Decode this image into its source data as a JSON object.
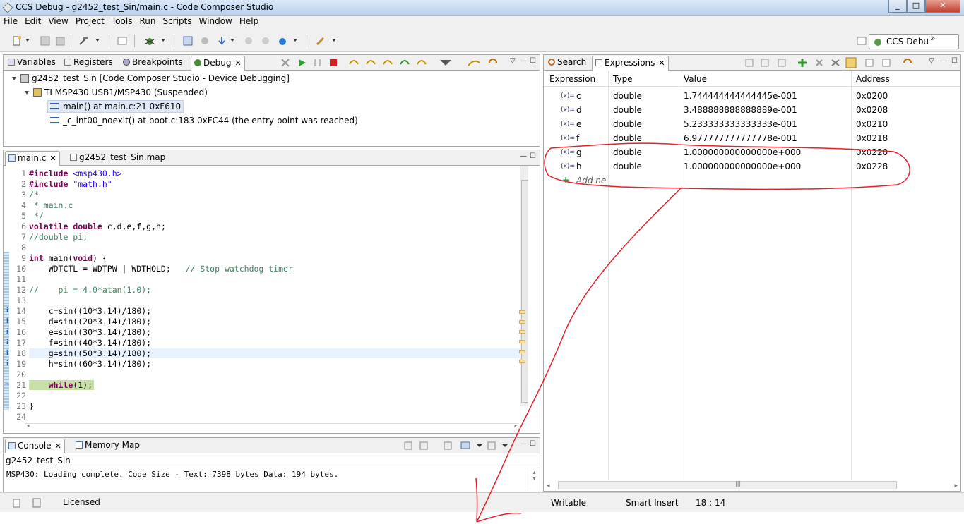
{
  "window": {
    "title": "CCS Debug - g2452_test_Sin/main.c - Code Composer Studio",
    "minimize": "_",
    "maximize": "□",
    "close": "✕"
  },
  "menu": [
    "File",
    "Edit",
    "View",
    "Project",
    "Tools",
    "Run",
    "Scripts",
    "Window",
    "Help"
  ],
  "perspective": {
    "label": "CCS Debu",
    "more": "»"
  },
  "debug_panel": {
    "tabs": [
      "Variables",
      "Registers",
      "Breakpoints",
      "Debug"
    ],
    "tree": [
      "g2452_test_Sin [Code Composer Studio - Device Debugging]",
      "TI MSP430 USB1/MSP430 (Suspended)",
      "main() at main.c:21 0xF610",
      "_c_int00_noexit() at boot.c:183 0xFC44  (the entry point was reached)"
    ]
  },
  "editor": {
    "tabs": [
      "main.c",
      "g2452_test_Sin.map"
    ],
    "lines": [
      {
        "n": "1",
        "t": "#include <msp430.h>"
      },
      {
        "n": "2",
        "t": "#include \"math.h\""
      },
      {
        "n": "3",
        "t": "/*"
      },
      {
        "n": "4",
        "t": " * main.c"
      },
      {
        "n": "5",
        "t": " */"
      },
      {
        "n": "6",
        "t": "volatile double c,d,e,f,g,h;"
      },
      {
        "n": "7",
        "t": "//double pi;"
      },
      {
        "n": "8",
        "t": ""
      },
      {
        "n": "9",
        "t": "int main(void) {"
      },
      {
        "n": "10",
        "t": "    WDTCTL = WDTPW | WDTHOLD;   // Stop watchdog timer"
      },
      {
        "n": "11",
        "t": ""
      },
      {
        "n": "12",
        "t": "//    pi = 4.0*atan(1.0);"
      },
      {
        "n": "13",
        "t": ""
      },
      {
        "n": "14",
        "t": "    c=sin((10*3.14)/180);"
      },
      {
        "n": "15",
        "t": "    d=sin((20*3.14)/180);"
      },
      {
        "n": "16",
        "t": "    e=sin((30*3.14)/180);"
      },
      {
        "n": "17",
        "t": "    f=sin((40*3.14)/180);"
      },
      {
        "n": "18",
        "t": "    g=sin((50*3.14)/180);"
      },
      {
        "n": "19",
        "t": "    h=sin((60*3.14)/180);"
      },
      {
        "n": "20",
        "t": ""
      },
      {
        "n": "21",
        "t": "    while(1);"
      },
      {
        "n": "22",
        "t": ""
      },
      {
        "n": "23",
        "t": "}"
      },
      {
        "n": "24",
        "t": ""
      }
    ]
  },
  "expressions_panel": {
    "tabs": [
      "Search",
      "Expressions"
    ],
    "columns": [
      "Expression",
      "Type",
      "Value",
      "Address"
    ],
    "rows": [
      {
        "expr": "c",
        "type": "double",
        "value": "1.744444444444445e-001",
        "addr": "0x0200"
      },
      {
        "expr": "d",
        "type": "double",
        "value": "3.488888888888889e-001",
        "addr": "0x0208"
      },
      {
        "expr": "e",
        "type": "double",
        "value": "5.233333333333333e-001",
        "addr": "0x0210"
      },
      {
        "expr": "f",
        "type": "double",
        "value": "6.977777777777778e-001",
        "addr": "0x0218"
      },
      {
        "expr": "g",
        "type": "double",
        "value": "1.000000000000000e+000",
        "addr": "0x0220"
      },
      {
        "expr": "h",
        "type": "double",
        "value": "1.000000000000000e+000",
        "addr": "0x0228"
      }
    ],
    "add_new": "Add ne",
    "var_icon": "(x)="
  },
  "console_panel": {
    "tabs": [
      "Console",
      "Memory Map"
    ],
    "title": "g2452_test_Sin",
    "text": "MSP430: Loading complete. Code Size - Text: 7398 bytes Data: 194 bytes."
  },
  "status": {
    "licensed": "Licensed",
    "writable": "Writable",
    "insert": "Smart Insert",
    "pos": "18 : 14"
  },
  "annotation_color": "#e8202a"
}
